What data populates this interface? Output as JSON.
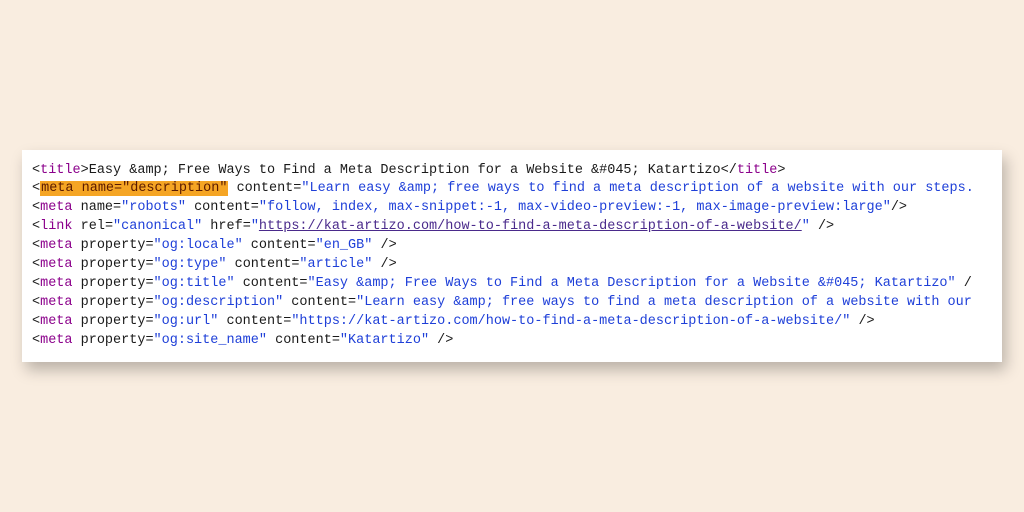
{
  "highlight_text": "meta name=\"description\"",
  "lines": [
    {
      "tag_open": "title",
      "attrs": [],
      "inner_text": "Easy &amp; Free Ways to Find a Meta Description for a Website &#045; Katartizo",
      "tag_close": "title",
      "self_close": false
    },
    {
      "tag_open": "meta",
      "highlighted_prefix": true,
      "attrs": [
        {
          "name": "content",
          "value": "Learn easy &amp; free ways to find a meta description of a website with our steps."
        }
      ],
      "self_close": true,
      "truncated": true
    },
    {
      "tag_open": "meta",
      "attrs": [
        {
          "name": "name",
          "value": "robots"
        },
        {
          "name": "content",
          "value": "follow, index, max-snippet:-1, max-video-preview:-1, max-image-preview:large"
        }
      ],
      "self_close": true,
      "end_slash": "/>"
    },
    {
      "tag_open": "link",
      "attrs": [
        {
          "name": "rel",
          "value": "canonical"
        },
        {
          "name": "href",
          "value": "https://kat-artizo.com/how-to-find-a-meta-description-of-a-website/",
          "is_link": true
        }
      ],
      "self_close": true,
      "space_before_close": true
    },
    {
      "tag_open": "meta",
      "attrs": [
        {
          "name": "property",
          "value": "og:locale"
        },
        {
          "name": "content",
          "value": "en_GB"
        }
      ],
      "self_close": true,
      "space_before_close": true
    },
    {
      "tag_open": "meta",
      "attrs": [
        {
          "name": "property",
          "value": "og:type"
        },
        {
          "name": "content",
          "value": "article"
        }
      ],
      "self_close": true,
      "space_before_close": true
    },
    {
      "tag_open": "meta",
      "attrs": [
        {
          "name": "property",
          "value": "og:title"
        },
        {
          "name": "content",
          "value": "Easy &amp; Free Ways to Find a Meta Description for a Website &#045; Katartizo"
        }
      ],
      "self_close": true,
      "space_before_close": true,
      "truncated_trail": " /"
    },
    {
      "tag_open": "meta",
      "attrs": [
        {
          "name": "property",
          "value": "og:description"
        },
        {
          "name": "content",
          "value": "Learn easy &amp; free ways to find a meta description of a website with our"
        }
      ],
      "truncated": true
    },
    {
      "tag_open": "meta",
      "attrs": [
        {
          "name": "property",
          "value": "og:url"
        },
        {
          "name": "content",
          "value": "https://kat-artizo.com/how-to-find-a-meta-description-of-a-website/"
        }
      ],
      "self_close": true,
      "space_before_close": true
    },
    {
      "tag_open": "meta",
      "attrs": [
        {
          "name": "property",
          "value": "og:site_name"
        },
        {
          "name": "content",
          "value": "Katartizo"
        }
      ],
      "self_close": true,
      "space_before_close": true
    }
  ]
}
